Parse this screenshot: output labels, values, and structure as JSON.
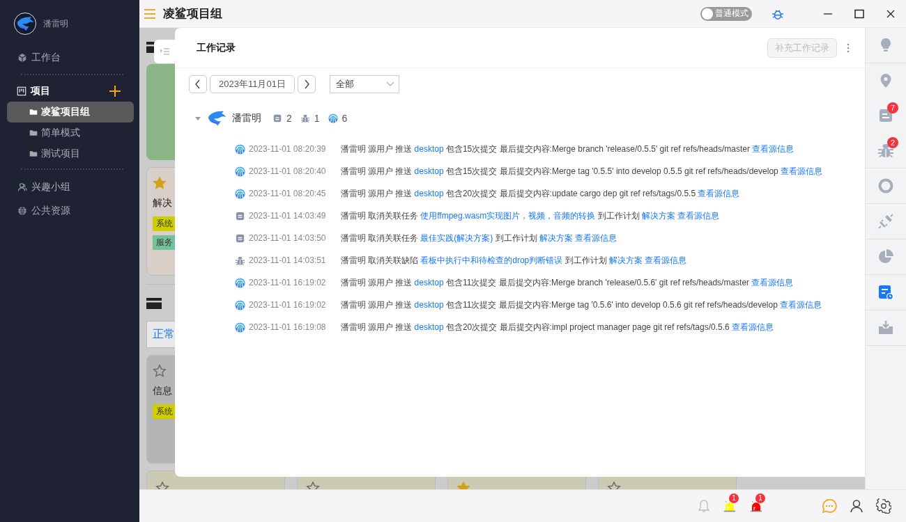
{
  "sidebar": {
    "user": "潘雷明",
    "items": [
      {
        "kind": "nav",
        "label": "工作台",
        "selected": false
      },
      {
        "kind": "section",
        "label": "项目",
        "children": [
          {
            "label": "凌鲨项目组",
            "selected": true
          },
          {
            "label": "简单模式",
            "selected": false
          },
          {
            "label": "测试项目",
            "selected": false
          }
        ]
      },
      {
        "kind": "nav",
        "label": "兴趣小组",
        "selected": false
      },
      {
        "kind": "nav",
        "label": "公共资源",
        "selected": false
      }
    ]
  },
  "header": {
    "title": "凌鲨项目组",
    "mode_toggle": {
      "label": "普通模式",
      "on": false
    }
  },
  "board": {
    "top_cards": [
      {
        "kind": "plain",
        "color": "#8bb587"
      },
      {
        "kind": "entry",
        "color": "#d8cfc9",
        "starred": true,
        "title": "解决",
        "tags": [
          {
            "label": "系统",
            "color": "#cfcf00"
          },
          {
            "label": "服务",
            "color": "#74c29a"
          }
        ]
      }
    ],
    "tabs": [
      {
        "label": "正常",
        "selected": true
      }
    ],
    "lower_cards": [
      {
        "kind": "entry",
        "color": "#b5b5b5",
        "starred": false,
        "title": "信息",
        "tags": [
          {
            "label": "系统",
            "color": "#cfcf00"
          }
        ]
      }
    ],
    "row_cards": [
      {
        "color": "#cbcab2",
        "starred": false
      },
      {
        "color": "#cbcab2",
        "starred": false
      },
      {
        "color": "#cbcab2",
        "starred": true
      },
      {
        "color": "#cbcab2",
        "starred": false
      }
    ]
  },
  "modal": {
    "title": "工作记录",
    "add_button": {
      "label": "补充工作记录",
      "disabled": true
    },
    "date": "2023年11月01日",
    "filter": "全部",
    "groups": [
      {
        "user": "潘雷明",
        "expanded": true,
        "counts": [
          {
            "kind": "task",
            "count": "2"
          },
          {
            "kind": "bug",
            "count": "1"
          },
          {
            "kind": "push",
            "count": "6"
          }
        ],
        "entries": [
          {
            "kind": "push",
            "time": "2023-11-01 08:20:39",
            "parts": [
              {
                "kind": "text",
                "text": "潘雷明 源用户 推送 "
              },
              {
                "kind": "link",
                "text": "desktop"
              },
              {
                "kind": "text",
                "text": " 包含15次提交 最后提交内容:Merge branch 'release/0.5.5' git ref refs/heads/master "
              },
              {
                "kind": "link",
                "text": "查看源信息"
              }
            ]
          },
          {
            "kind": "push",
            "time": "2023-11-01 08:20:40",
            "parts": [
              {
                "kind": "text",
                "text": "潘雷明 源用户 推送 "
              },
              {
                "kind": "link",
                "text": "desktop"
              },
              {
                "kind": "text",
                "text": " 包含15次提交 最后提交内容:Merge tag '0.5.5' into develop 0.5.5 git ref refs/heads/develop "
              },
              {
                "kind": "link",
                "text": "查看源信息"
              }
            ]
          },
          {
            "kind": "push",
            "time": "2023-11-01 08:20:45",
            "parts": [
              {
                "kind": "text",
                "text": "潘雷明 源用户 推送 "
              },
              {
                "kind": "link",
                "text": "desktop"
              },
              {
                "kind": "text",
                "text": " 包含20次提交 最后提交内容:update cargo dep git ref refs/tags/0.5.5 "
              },
              {
                "kind": "link",
                "text": "查看源信息"
              }
            ]
          },
          {
            "kind": "task",
            "time": "2023-11-01 14:03:49",
            "parts": [
              {
                "kind": "text",
                "text": "潘雷明 取消关联任务 "
              },
              {
                "kind": "link",
                "text": "使用ffmpeg.wasm实现图片，视频，音频的转换"
              },
              {
                "kind": "text",
                "text": " 到工作计划 "
              },
              {
                "kind": "link",
                "text": "解决方案"
              },
              {
                "kind": "link",
                "text": "查看源信息"
              }
            ]
          },
          {
            "kind": "task",
            "time": "2023-11-01 14:03:50",
            "parts": [
              {
                "kind": "text",
                "text": "潘雷明 取消关联任务 "
              },
              {
                "kind": "link",
                "text": "最佳实践(解决方案)"
              },
              {
                "kind": "text",
                "text": " 到工作计划 "
              },
              {
                "kind": "link",
                "text": "解决方案"
              },
              {
                "kind": "link",
                "text": "查看源信息"
              }
            ]
          },
          {
            "kind": "bug",
            "time": "2023-11-01 14:03:51",
            "parts": [
              {
                "kind": "text",
                "text": "潘雷明 取消关联缺陷 "
              },
              {
                "kind": "link",
                "text": "看板中执行中和待检查的drop判断错误"
              },
              {
                "kind": "text",
                "text": " 到工作计划 "
              },
              {
                "kind": "link",
                "text": "解决方案"
              },
              {
                "kind": "link",
                "text": "查看源信息"
              }
            ]
          },
          {
            "kind": "push",
            "time": "2023-11-01 16:19:02",
            "parts": [
              {
                "kind": "text",
                "text": "潘雷明 源用户 推送 "
              },
              {
                "kind": "link",
                "text": "desktop"
              },
              {
                "kind": "text",
                "text": " 包含11次提交 最后提交内容:Merge branch 'release/0.5.6' git ref refs/heads/master "
              },
              {
                "kind": "link",
                "text": "查看源信息"
              }
            ]
          },
          {
            "kind": "push",
            "time": "2023-11-01 16:19:02",
            "parts": [
              {
                "kind": "text",
                "text": "潘雷明 源用户 推送 "
              },
              {
                "kind": "link",
                "text": "desktop"
              },
              {
                "kind": "text",
                "text": " 包含11次提交 最后提交内容:Merge tag '0.5.6' into develop 0.5.6 git ref refs/heads/develop "
              },
              {
                "kind": "link",
                "text": "查看源信息"
              }
            ]
          },
          {
            "kind": "push",
            "time": "2023-11-01 16:19:08",
            "parts": [
              {
                "kind": "text",
                "text": "潘雷明 源用户 推送 "
              },
              {
                "kind": "link",
                "text": "desktop"
              },
              {
                "kind": "text",
                "text": " 包含20次提交 最后提交内容:impl project manager page git ref refs/tags/0.5.6 "
              },
              {
                "kind": "link",
                "text": "查看源信息"
              }
            ]
          }
        ]
      }
    ]
  },
  "right_rail": [
    {
      "items": [
        {
          "kind": "bulb",
          "selected": false
        }
      ]
    },
    {
      "items": [
        {
          "kind": "pin",
          "selected": false
        },
        {
          "kind": "doc",
          "badge": "7",
          "selected": false
        },
        {
          "kind": "bug",
          "badge": "2",
          "selected": false
        }
      ]
    },
    {
      "items": [
        {
          "kind": "ring",
          "selected": false
        }
      ]
    },
    {
      "items": [
        {
          "kind": "plug",
          "selected": false
        }
      ]
    },
    {
      "items": [
        {
          "kind": "pie",
          "selected": false
        }
      ]
    },
    {
      "items": [
        {
          "kind": "schedule",
          "selected": true
        }
      ]
    },
    {
      "items": [
        {
          "kind": "download",
          "selected": false
        }
      ]
    }
  ],
  "status_bar": [
    {
      "kind": "bell"
    },
    {
      "kind": "alarm",
      "color": "#ffff00",
      "badge": "1"
    },
    {
      "kind": "alarm",
      "color": "#ff0000",
      "badge": "1"
    },
    {
      "kind": "gap"
    },
    {
      "kind": "chat"
    },
    {
      "kind": "user"
    },
    {
      "kind": "gear"
    }
  ]
}
